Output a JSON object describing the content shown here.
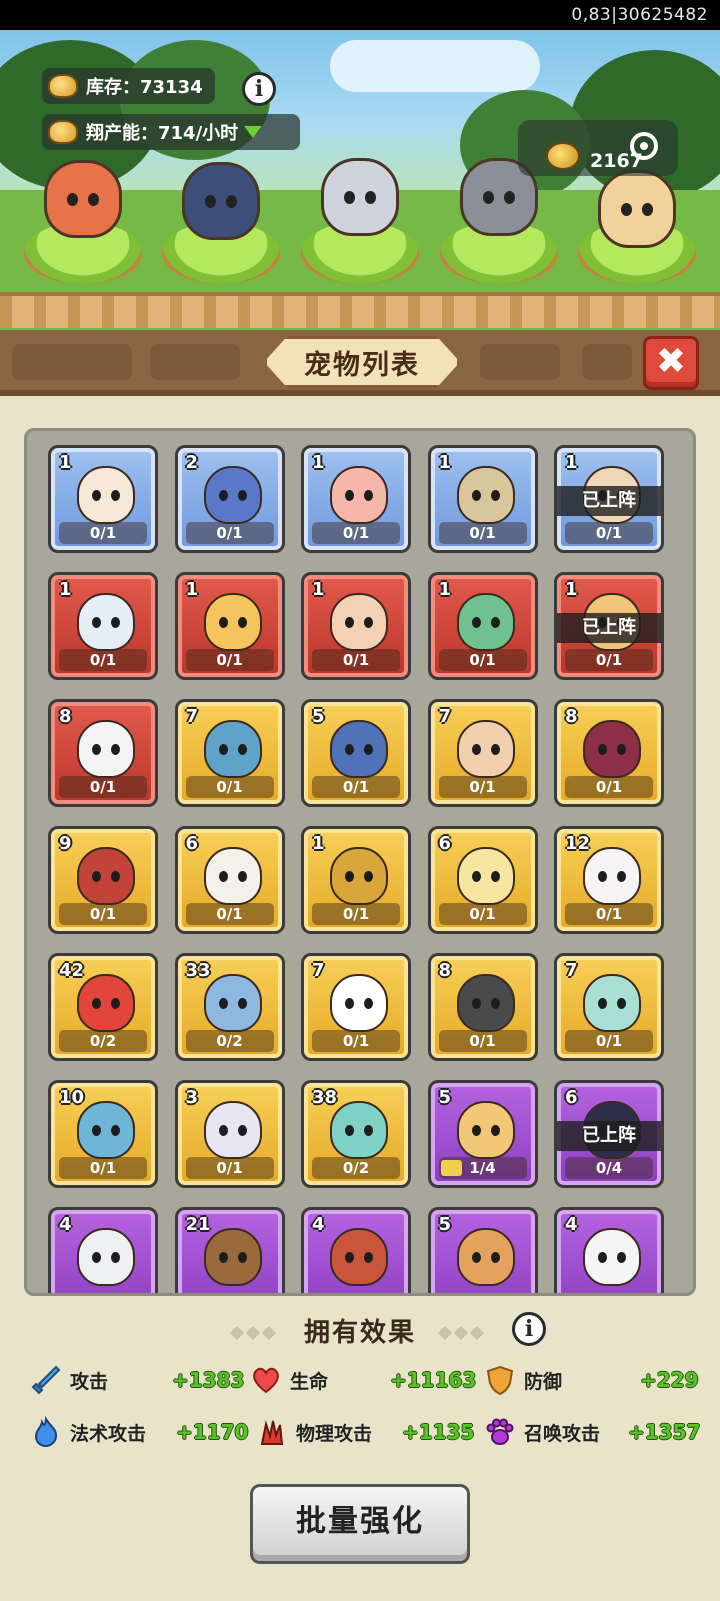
{
  "status_bar": {
    "session_id": "0,83|30625482"
  },
  "resources": {
    "inventory_label": "库存：73134",
    "production_label": "翔产能：714/小时",
    "gold_value": "2167"
  },
  "panel": {
    "title": "宠物列表",
    "close_label": "✖"
  },
  "pets": [
    {
      "level": "1",
      "count": "0/1",
      "rarity": "blue",
      "deployed": false,
      "color": "#f6e7d7"
    },
    {
      "level": "2",
      "count": "0/1",
      "rarity": "blue",
      "deployed": false,
      "color": "#5b78c8"
    },
    {
      "level": "1",
      "count": "0/1",
      "rarity": "blue",
      "deployed": false,
      "color": "#f4b7a8"
    },
    {
      "level": "1",
      "count": "0/1",
      "rarity": "blue",
      "deployed": false,
      "color": "#d9c69a"
    },
    {
      "level": "1",
      "count": "0/1",
      "rarity": "blue",
      "deployed": true,
      "color": "#f0d7b8"
    },
    {
      "level": "1",
      "count": "0/1",
      "rarity": "red",
      "deployed": false,
      "color": "#e5eef6"
    },
    {
      "level": "1",
      "count": "0/1",
      "rarity": "red",
      "deployed": false,
      "color": "#f5c45c"
    },
    {
      "level": "1",
      "count": "0/1",
      "rarity": "red",
      "deployed": false,
      "color": "#f3d1b5"
    },
    {
      "level": "1",
      "count": "0/1",
      "rarity": "red",
      "deployed": false,
      "color": "#6fc28f"
    },
    {
      "level": "1",
      "count": "0/1",
      "rarity": "red",
      "deployed": true,
      "color": "#f2c47a"
    },
    {
      "level": "8",
      "count": "0/1",
      "rarity": "red",
      "deployed": false,
      "color": "#f3f3f3"
    },
    {
      "level": "7",
      "count": "0/1",
      "rarity": "gold",
      "deployed": false,
      "color": "#5fa4c8"
    },
    {
      "level": "5",
      "count": "0/1",
      "rarity": "gold",
      "deployed": false,
      "color": "#4f72b8"
    },
    {
      "level": "7",
      "count": "0/1",
      "rarity": "gold",
      "deployed": false,
      "color": "#f1d0ae"
    },
    {
      "level": "8",
      "count": "0/1",
      "rarity": "gold",
      "deployed": false,
      "color": "#8d2f46"
    },
    {
      "level": "9",
      "count": "0/1",
      "rarity": "gold",
      "deployed": false,
      "color": "#c2433a"
    },
    {
      "level": "6",
      "count": "0/1",
      "rarity": "gold",
      "deployed": false,
      "color": "#f4f1ea"
    },
    {
      "level": "1",
      "count": "0/1",
      "rarity": "gold",
      "deployed": false,
      "color": "#d8a63a"
    },
    {
      "level": "6",
      "count": "0/1",
      "rarity": "gold",
      "deployed": false,
      "color": "#f6e6a0"
    },
    {
      "level": "12",
      "count": "0/1",
      "rarity": "gold",
      "deployed": false,
      "color": "#f6f3f5"
    },
    {
      "level": "42",
      "count": "0/2",
      "rarity": "gold",
      "deployed": false,
      "color": "#e2453a"
    },
    {
      "level": "33",
      "count": "0/2",
      "rarity": "gold",
      "deployed": false,
      "color": "#8fb8e0"
    },
    {
      "level": "7",
      "count": "0/1",
      "rarity": "gold",
      "deployed": false,
      "color": "#ffffff"
    },
    {
      "level": "8",
      "count": "0/1",
      "rarity": "gold",
      "deployed": false,
      "color": "#4a4a4a"
    },
    {
      "level": "7",
      "count": "0/1",
      "rarity": "gold",
      "deployed": false,
      "color": "#a8e0d6"
    },
    {
      "level": "10",
      "count": "0/1",
      "rarity": "gold",
      "deployed": false,
      "color": "#6fb6d6"
    },
    {
      "level": "3",
      "count": "0/1",
      "rarity": "gold",
      "deployed": false,
      "color": "#e9e6f4"
    },
    {
      "level": "38",
      "count": "0/2",
      "rarity": "gold",
      "deployed": false,
      "color": "#7fd0c5"
    },
    {
      "level": "5",
      "count": "1/4",
      "rarity": "purple",
      "deployed": false,
      "progress": 0.25,
      "color": "#f2c878"
    },
    {
      "level": "6",
      "count": "0/4",
      "rarity": "purple",
      "deployed": true,
      "color": "#2e2e4a"
    },
    {
      "level": "4",
      "count": "",
      "rarity": "purple",
      "deployed": false,
      "color": "#eef0f3"
    },
    {
      "level": "21",
      "count": "",
      "rarity": "purple",
      "deployed": false,
      "color": "#9a6a3c"
    },
    {
      "level": "4",
      "count": "",
      "rarity": "purple",
      "deployed": false,
      "color": "#c9553b"
    },
    {
      "level": "5",
      "count": "",
      "rarity": "purple",
      "deployed": false,
      "color": "#e3a35c"
    },
    {
      "level": "4",
      "count": "",
      "rarity": "purple",
      "deployed": false,
      "color": "#f4f4f4"
    }
  ],
  "deployed_label": "已上阵",
  "effects": {
    "title": "拥有效果",
    "stats": [
      {
        "name": "攻击",
        "value": "+1383",
        "icon": "sword-icon"
      },
      {
        "name": "生命",
        "value": "+11163",
        "icon": "heart-icon"
      },
      {
        "name": "防御",
        "value": "+229",
        "icon": "shield-icon"
      },
      {
        "name": "法术攻击",
        "value": "+1170",
        "icon": "fire-icon"
      },
      {
        "name": "物理攻击",
        "value": "+1135",
        "icon": "claw-icon"
      },
      {
        "name": "召唤攻击",
        "value": "+1357",
        "icon": "paw-icon"
      }
    ]
  },
  "batch_button": {
    "label": "批量强化"
  },
  "scene_pets": [
    {
      "color": "#e8734a"
    },
    {
      "color": "#3c4e7a"
    },
    {
      "color": "#cfd3dd"
    },
    {
      "color": "#8a8f98"
    },
    {
      "color": "#f0d29a"
    }
  ]
}
